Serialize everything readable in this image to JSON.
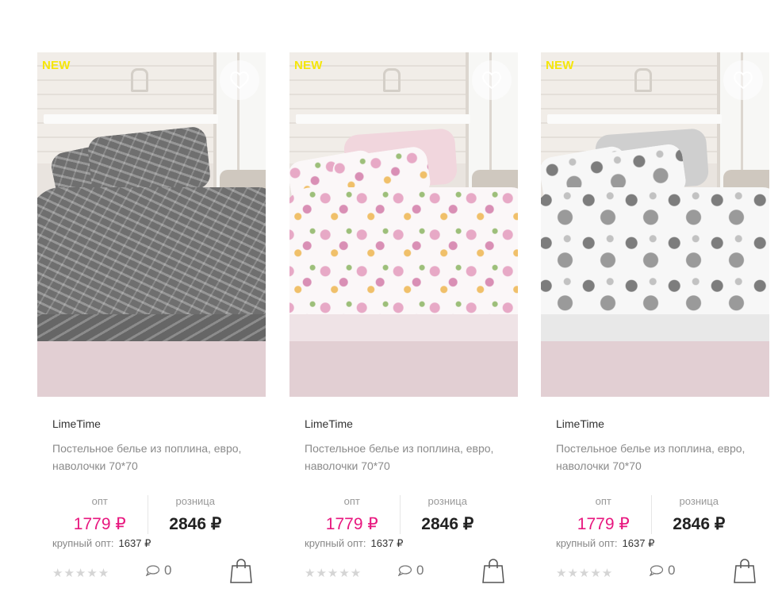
{
  "products": [
    {
      "badge": "NEW",
      "brand": "LimeTime",
      "description": "Постельное белье из поплина, евро, наволочки 70*70",
      "opt_label": "опт",
      "opt_price": "1779 ₽",
      "retail_label": "розница",
      "retail_price": "2846 ₽",
      "bulk_label": "крупный опт:",
      "bulk_price": "1637 ₽",
      "stars": "★★★★★",
      "comments": "0",
      "pattern": "gray-cities"
    },
    {
      "badge": "NEW",
      "brand": "LimeTime",
      "description": "Постельное белье из поплина, евро, наволочки 70*70",
      "opt_label": "опт",
      "opt_price": "1779 ₽",
      "retail_label": "розница",
      "retail_price": "2846 ₽",
      "bulk_label": "крупный опт:",
      "bulk_price": "1637 ₽",
      "stars": "★★★★★",
      "comments": "0",
      "pattern": "floral"
    },
    {
      "badge": "NEW",
      "brand": "LimeTime",
      "description": "Постельное белье из поплина, евро, наволочки 70*70",
      "opt_label": "опт",
      "opt_price": "1779 ₽",
      "retail_label": "розница",
      "retail_price": "2846 ₽",
      "bulk_label": "крупный опт:",
      "bulk_price": "1637 ₽",
      "stars": "★★★★★",
      "comments": "0",
      "pattern": "stars"
    }
  ],
  "colors": {
    "opt_price": "#e8177f",
    "badge": "#f5e60a",
    "rating_inactive": "#d5d5d5"
  },
  "icons": {
    "favorite": "heart-icon",
    "comments": "comment-bubble-icon",
    "cart": "shopping-bag-icon"
  }
}
